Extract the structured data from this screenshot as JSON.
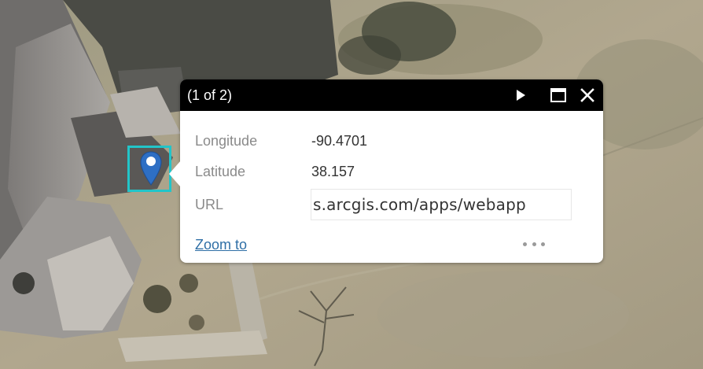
{
  "popup": {
    "title": "(1 of 2)",
    "fields": [
      {
        "label": "Longitude",
        "value": "-90.4701"
      },
      {
        "label": "Latitude",
        "value": "38.157"
      },
      {
        "label": "URL",
        "value": "s.arcgis.com/apps/webapp"
      }
    ],
    "zoom_label": "Zoom to",
    "icons": {
      "next": "play-next-icon",
      "maximize": "maximize-icon",
      "close": "close-icon",
      "more": "ellipsis-icon"
    }
  },
  "marker": {
    "icon": "location-pin-icon",
    "selection_color": "#22c5c9",
    "pin_color": "#2e6fc4"
  },
  "colors": {
    "header_bg": "#000000",
    "link": "#2f6fa6",
    "label": "#8a8a8a"
  }
}
